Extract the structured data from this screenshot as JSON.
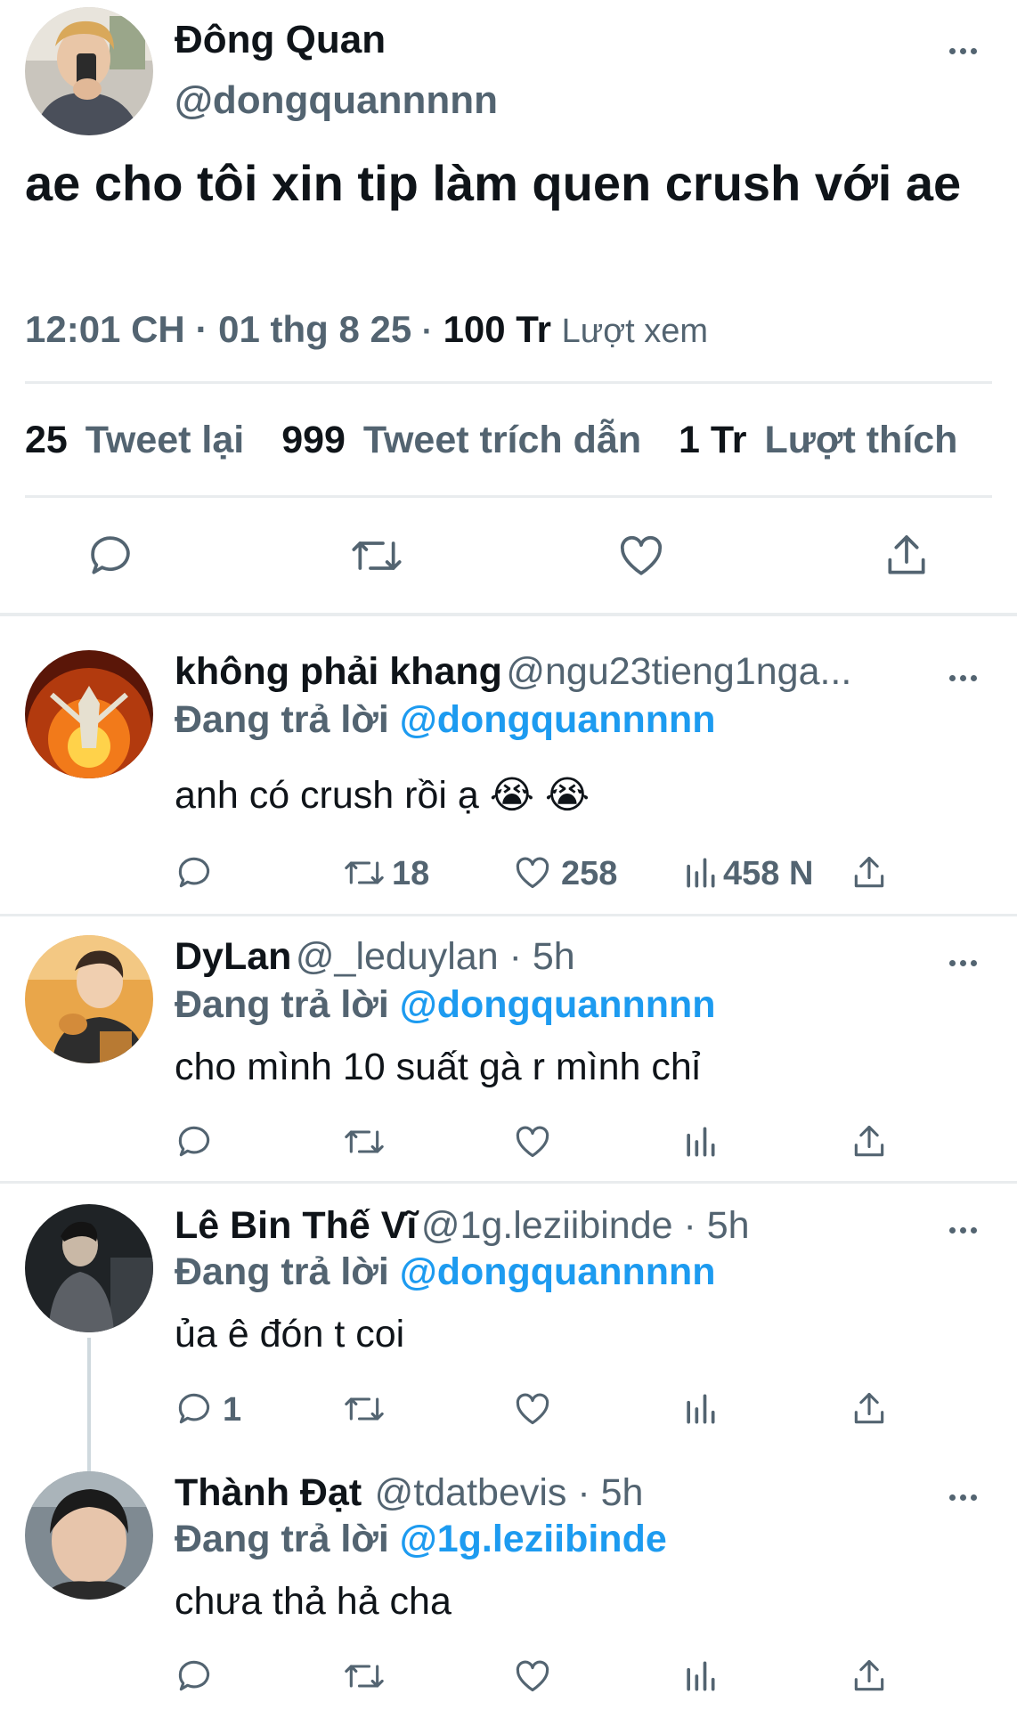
{
  "main_tweet": {
    "author_name": "Đông Quan",
    "author_handle": "@dongquannnnn",
    "text": "ae cho tôi xin tip làm quen crush với ae",
    "time": "12:01 CH",
    "date": "01 thg 8 25",
    "separator": "·",
    "views_count": "100 Tr",
    "views_label": "Lượt xem",
    "retweets_count": "25",
    "retweets_label": "Tweet lại",
    "quotes_count": "999",
    "quotes_label": "Tweet trích dẫn",
    "likes_count": "1 Tr",
    "likes_label": "Lượt thích"
  },
  "replies": [
    {
      "name": "không phải khang",
      "handle": "@ngu23tieng1nga...",
      "replying_prefix": "Đang trả lời",
      "replying_to": "@dongquannnnn",
      "text": "anh có crush rồi ạ 😭 😭",
      "reply_count": "",
      "retweet_count": "18",
      "like_count": "258",
      "view_count": "458 N"
    },
    {
      "name": "DyLan",
      "handle": "@_leduylan · 5h",
      "replying_prefix": "Đang trả lời",
      "replying_to": "@dongquannnnn",
      "text": "cho mình 10 suất gà r mình chỉ",
      "reply_count": "",
      "retweet_count": "",
      "like_count": "",
      "view_count": ""
    },
    {
      "name": "Lê Bin Thế Vĩ",
      "handle": "@1g.leziibinde · 5h",
      "replying_prefix": "Đang trả lời",
      "replying_to": "@dongquannnnn",
      "text": "ủa ê đón t coi",
      "reply_count": "1",
      "retweet_count": "",
      "like_count": "",
      "view_count": ""
    },
    {
      "name": "Thành Đạt",
      "handle": "@tdatbevis · 5h",
      "replying_prefix": "Đang trả lời",
      "replying_to": "@1g.leziibinde",
      "text": "chưa thả hả cha",
      "reply_count": "",
      "retweet_count": "",
      "like_count": "",
      "view_count": ""
    }
  ],
  "icons": {
    "reply": "reply-icon",
    "retweet": "retweet-icon",
    "like": "heart-icon",
    "views": "views-icon",
    "share": "share-icon",
    "more": "more-icon"
  },
  "colors": {
    "accent": "#1d9bf0",
    "text": "#0f1419",
    "muted": "#536471",
    "divider": "#e9ecee"
  }
}
